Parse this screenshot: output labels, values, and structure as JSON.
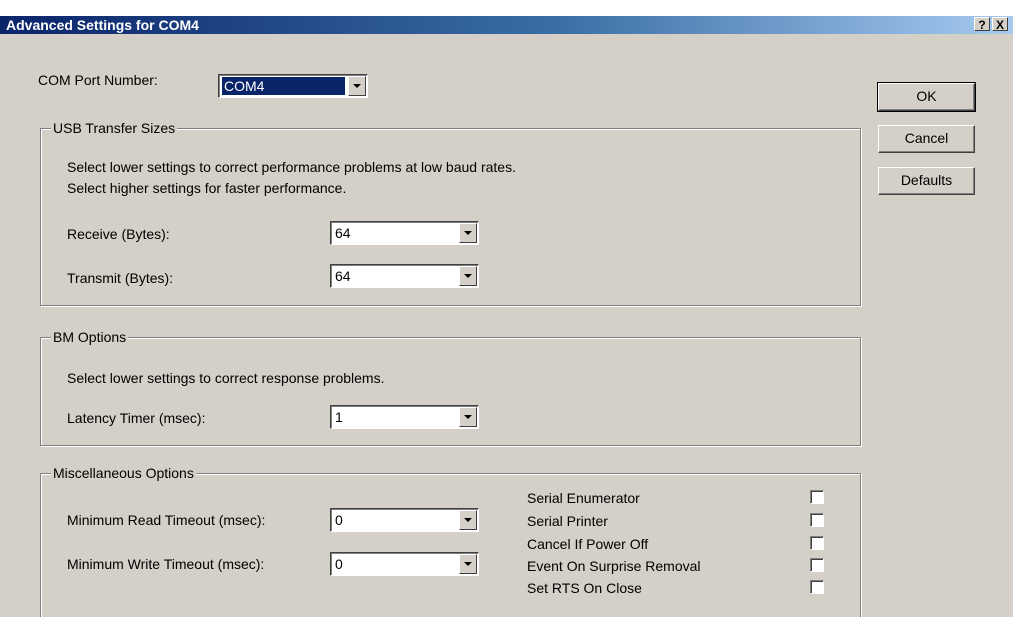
{
  "window": {
    "title": "Advanced Settings for COM4",
    "help_button": "?",
    "close_button": "X"
  },
  "com_port": {
    "label": "COM Port Number:",
    "value": "COM4"
  },
  "buttons": {
    "ok": "OK",
    "cancel": "Cancel",
    "defaults": "Defaults"
  },
  "usb_transfer": {
    "legend": "USB Transfer Sizes",
    "desc1": "Select lower settings to correct performance problems at low baud rates.",
    "desc2": "Select higher settings for faster performance.",
    "receive_label": "Receive (Bytes):",
    "receive_value": "64",
    "transmit_label": "Transmit (Bytes):",
    "transmit_value": "64"
  },
  "bm_options": {
    "legend": "BM Options",
    "desc": "Select lower settings to correct response problems.",
    "latency_label": "Latency Timer (msec):",
    "latency_value": "1"
  },
  "misc": {
    "legend": "Miscellaneous Options",
    "read_timeout_label": "Minimum Read Timeout (msec):",
    "read_timeout_value": "0",
    "write_timeout_label": "Minimum Write Timeout (msec):",
    "write_timeout_value": "0",
    "checkboxes": [
      {
        "label": "Serial Enumerator",
        "checked": false
      },
      {
        "label": "Serial Printer",
        "checked": false
      },
      {
        "label": "Cancel If Power Off",
        "checked": false
      },
      {
        "label": "Event On Surprise Removal",
        "checked": false
      },
      {
        "label": "Set RTS On Close",
        "checked": false
      }
    ]
  }
}
